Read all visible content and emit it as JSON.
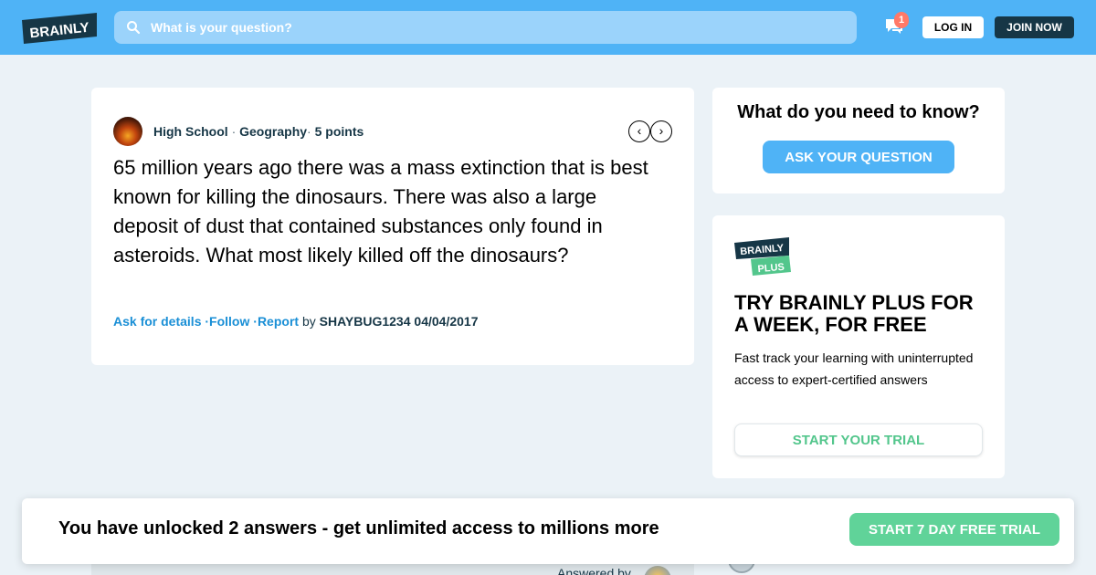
{
  "header": {
    "logo_text": "BRAINLY",
    "search_placeholder": "What is your question?",
    "notification_count": "1",
    "login_label": "LOG IN",
    "join_label": "JOIN NOW",
    "bar_color": "#4fb3f6"
  },
  "question": {
    "level": "High School",
    "subject": "Geography",
    "points": "5 points",
    "sep": "·",
    "prev_icon": "chevron-left-icon",
    "next_icon": "chevron-right-icon",
    "text": "65 million years ago there was a mass extinction that is best known for killing the dinosaurs. There was also a large deposit of dust that contained substances only found in asteroids. What most likely killed off the dinosaurs?",
    "actions": {
      "ask_details": "Ask for details",
      "follow": "Follow",
      "report": "Report",
      "by": "by",
      "author": "SHAYBUG1234",
      "date": "04/04/2017"
    }
  },
  "ask_box": {
    "title": "What do you need to know?",
    "button": "ASK YOUR QUESTION"
  },
  "plus": {
    "logo_top": "BRAINLY",
    "logo_bottom": "PLUS",
    "title": "TRY BRAINLY PLUS FOR A WEEK, FOR FREE",
    "description": "Fast track your learning with uninterrupted access to expert-certified answers",
    "button": "START YOUR TRIAL",
    "accent": "#53c68c"
  },
  "peek": {
    "answered_by": "Answered by"
  },
  "banner": {
    "text": "You have unlocked 2 answers - get unlimited access to millions more",
    "button": "START 7 DAY FREE TRIAL",
    "button_color": "#60d399"
  }
}
